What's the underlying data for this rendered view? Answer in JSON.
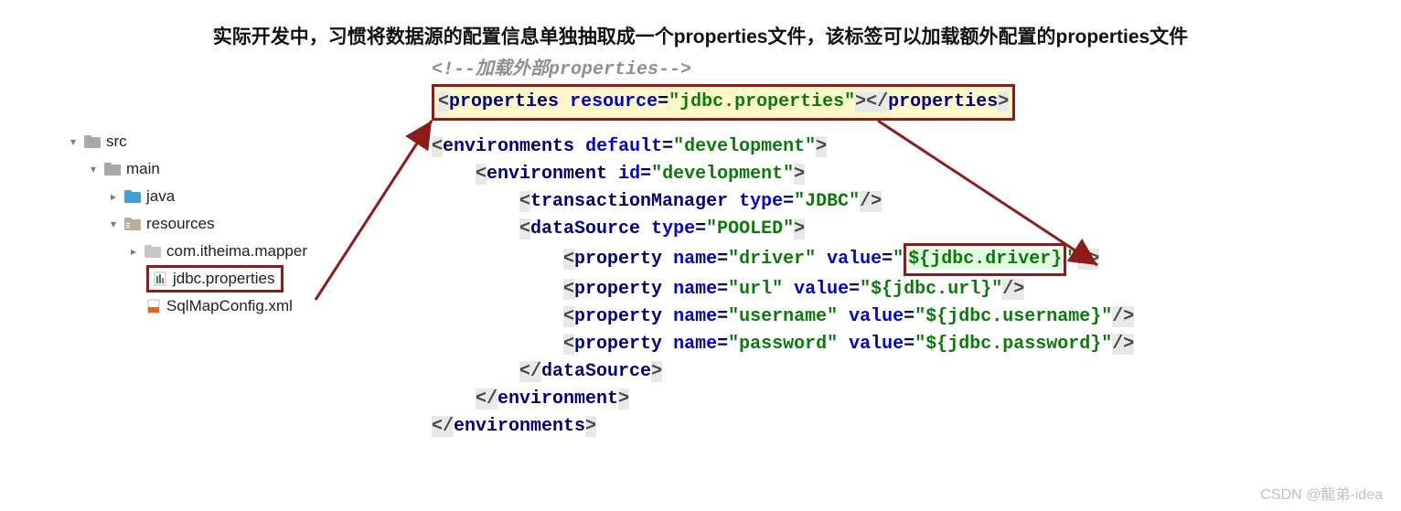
{
  "title": "实际开发中，习惯将数据源的配置信息单独抽取成一个properties文件，该标签可以加载额外配置的properties文件",
  "tree": {
    "src": "src",
    "main": "main",
    "java": "java",
    "resources": "resources",
    "mapper": "com.itheima.mapper",
    "jdbc": "jdbc.properties",
    "sqlmap": "SqlMapConfig.xml"
  },
  "code": {
    "comment_open": "<!--",
    "comment_text": "加载外部properties",
    "comment_close": "-->",
    "properties_open": "properties",
    "resource_attr": "resource",
    "resource_val": "\"jdbc.properties\"",
    "environments": "environments",
    "default_attr": "default",
    "default_val": "\"development\"",
    "environment": "environment",
    "id_attr": "id",
    "id_val": "\"development\"",
    "txmgr": "transactionManager",
    "type_attr": "type",
    "txmgr_val": "\"JDBC\"",
    "datasource": "dataSource",
    "ds_val": "\"POOLED\"",
    "property": "property",
    "name_attr": "name",
    "value_attr": "value",
    "p1_name": "\"driver\"",
    "p1_val": "\"${jdbc.driver}\"",
    "p2_name": "\"url\"",
    "p2_val": "\"${jdbc.url}\"",
    "p3_name": "\"username\"",
    "p3_val": "\"${jdbc.username}\"",
    "p4_name": "\"password\"",
    "p4_val": "\"${jdbc.password}\""
  },
  "watermark": "CSDN @龍弟-idea"
}
